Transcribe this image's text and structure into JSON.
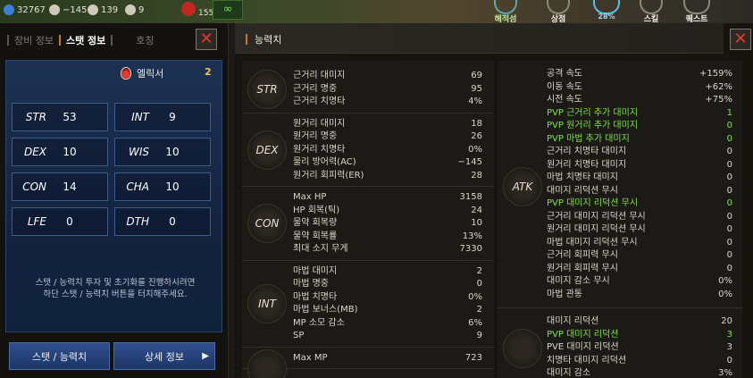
{
  "hud": {
    "stats": [
      {
        "icon": "crystal-icon",
        "value": "32767"
      },
      {
        "icon": "skull-icon",
        "value": "−145"
      },
      {
        "icon": "boot-icon",
        "value": "139"
      },
      {
        "icon": "pet-icon",
        "value": "9"
      }
    ],
    "potion_count": "155",
    "menus": [
      "해적섬",
      "상점",
      "스킬",
      "퀘스트"
    ],
    "exp_percent": "28%"
  },
  "left_panel": {
    "tabs": [
      "장비 정보",
      "스탯 정보",
      "호칭"
    ],
    "active_tab": "스탯 정보",
    "elixir_label": "엘릭서",
    "elixir_count": "2",
    "stats": [
      {
        "name": "STR",
        "value": "53"
      },
      {
        "name": "INT",
        "value": "9"
      },
      {
        "name": "DEX",
        "value": "10"
      },
      {
        "name": "WIS",
        "value": "10"
      },
      {
        "name": "CON",
        "value": "14"
      },
      {
        "name": "CHA",
        "value": "10"
      },
      {
        "name": "LFE",
        "value": "0"
      },
      {
        "name": "DTH",
        "value": "0"
      }
    ],
    "notice_line1": "스탯 / 능력치 투자 및 초기화를 진행하시려면",
    "notice_line2": "하단 스탯 / 능력치 버튼을 터치해주세요.",
    "btn_stat": "스탯 / 능력치",
    "btn_detail": "상세 정보",
    "close": "✕"
  },
  "right_panel": {
    "title": "능력치",
    "close": "✕",
    "groups": [
      {
        "label": "STR",
        "rows": [
          {
            "name": "근거리 대미지",
            "value": "69"
          },
          {
            "name": "근거리 명중",
            "value": "95"
          },
          {
            "name": "근거리 치명타",
            "value": "4%"
          }
        ]
      },
      {
        "label": "DEX",
        "rows": [
          {
            "name": "원거리 대미지",
            "value": "18"
          },
          {
            "name": "원거리 명중",
            "value": "26"
          },
          {
            "name": "원거리 치명타",
            "value": "0%"
          },
          {
            "name": "물리 방어력(AC)",
            "value": "−145"
          },
          {
            "name": "원거리 회피력(ER)",
            "value": "28"
          }
        ]
      },
      {
        "label": "CON",
        "rows": [
          {
            "name": "Max HP",
            "value": "3158"
          },
          {
            "name": "HP 회복(틱)",
            "value": "24"
          },
          {
            "name": "물약 회복량",
            "value": "10"
          },
          {
            "name": "물약 회복률",
            "value": "13%"
          },
          {
            "name": "최대 소지 무게",
            "value": "7330"
          }
        ]
      },
      {
        "label": "INT",
        "rows": [
          {
            "name": "마법 대미지",
            "value": "2"
          },
          {
            "name": "마법 명중",
            "value": "0"
          },
          {
            "name": "마법 치명타",
            "value": "0%"
          },
          {
            "name": "마법 보너스(MB)",
            "value": "2"
          },
          {
            "name": "MP 소모 감소",
            "value": "6%"
          },
          {
            "name": "SP",
            "value": "9"
          }
        ]
      },
      {
        "label": "",
        "rows": [
          {
            "name": "Max MP",
            "value": "723"
          }
        ]
      }
    ],
    "atk_group": {
      "label": "ATK",
      "rows": [
        {
          "name": "공격 속도",
          "value": "+159%",
          "pvp": false
        },
        {
          "name": "이동 속도",
          "value": "+62%",
          "pvp": false
        },
        {
          "name": "시전 속도",
          "value": "+75%",
          "pvp": false
        },
        {
          "name": "PVP 근거리 추가 대미지",
          "value": "1",
          "pvp": true
        },
        {
          "name": "PVP 원거리 추가 대미지",
          "value": "0",
          "pvp": true
        },
        {
          "name": "PVP 마법 추가 대미지",
          "value": "0",
          "pvp": true
        },
        {
          "name": "근거리 치명타 대미지",
          "value": "0",
          "pvp": false
        },
        {
          "name": "원거리 치명타 대미지",
          "value": "0",
          "pvp": false
        },
        {
          "name": "마법 치명타 대미지",
          "value": "0",
          "pvp": false
        },
        {
          "name": "대미지 리덕션 무시",
          "value": "0",
          "pvp": false
        },
        {
          "name": "PVP 대미지 리덕션 무시",
          "value": "0",
          "pvp": true
        },
        {
          "name": "근거리 대미지 리덕션 무시",
          "value": "0",
          "pvp": false
        },
        {
          "name": "원거리 대미지 리덕션 무시",
          "value": "0",
          "pvp": false
        },
        {
          "name": "마법 대미지 리덕션 무시",
          "value": "0",
          "pvp": false
        },
        {
          "name": "근거리 회피력 무시",
          "value": "0",
          "pvp": false
        },
        {
          "name": "원거리 회피력 무시",
          "value": "0",
          "pvp": false
        },
        {
          "name": "대미지 감소 무시",
          "value": "0%",
          "pvp": false
        },
        {
          "name": "마법 관통",
          "value": "0%",
          "pvp": false
        }
      ]
    },
    "def_group": {
      "label": "",
      "rows": [
        {
          "name": "대미지 리덕션",
          "value": "20",
          "pvp": false
        },
        {
          "name": "PVP 대미지 리덕션",
          "value": "3",
          "pvp": true
        },
        {
          "name": "PVE 대미지 리덕션",
          "value": "3",
          "pvp": false
        },
        {
          "name": "치명타 대미지 리덕션",
          "value": "0",
          "pvp": false
        },
        {
          "name": "대미지 감소",
          "value": "3%",
          "pvp": false
        }
      ]
    }
  }
}
